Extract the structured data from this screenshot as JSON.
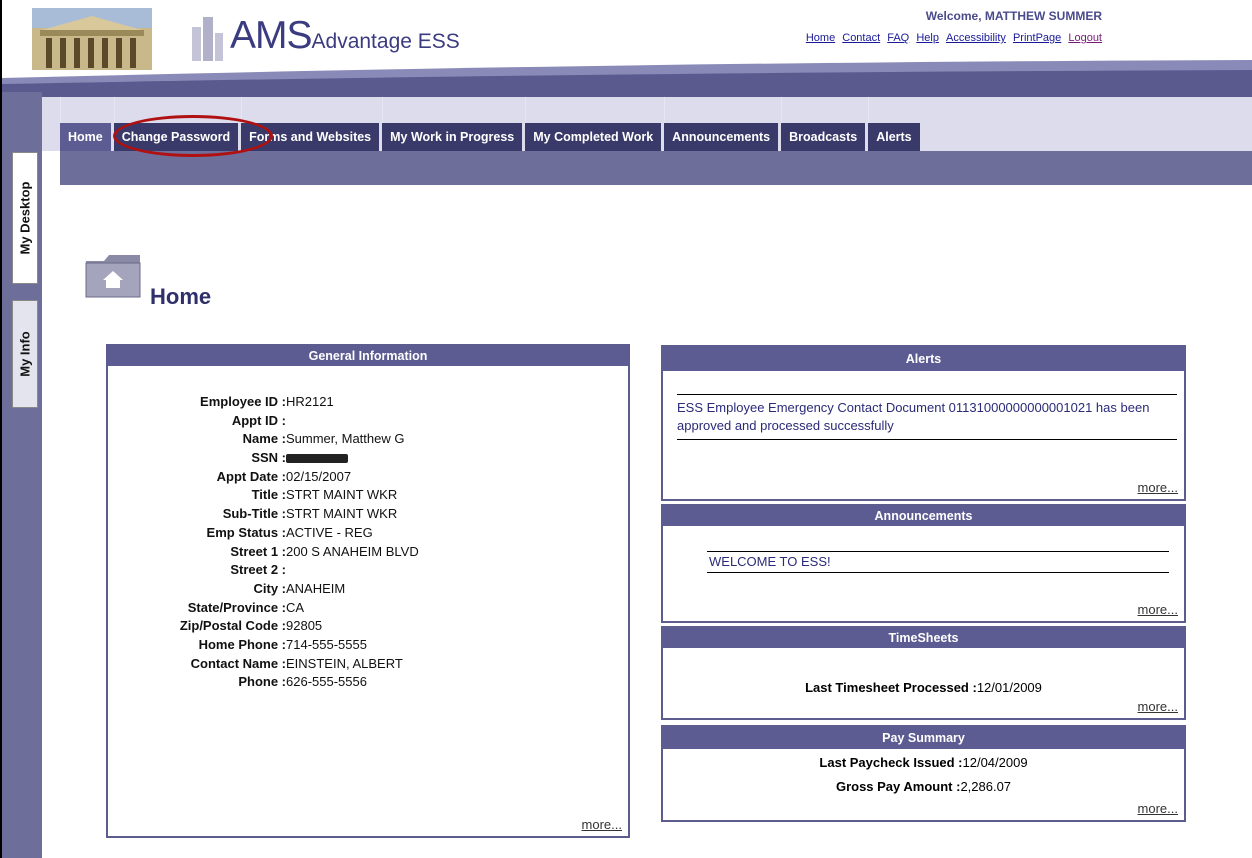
{
  "header": {
    "app_title_main": "AMS",
    "app_title_sub": "Advantage ESS",
    "welcome": "Welcome, MATTHEW SUMMER",
    "links": [
      "Home",
      "Contact",
      "FAQ",
      "Help",
      "Accessibility",
      "PrintPage",
      "Logout"
    ]
  },
  "tabs": [
    "Home",
    "Change Password",
    "Forms and Websites",
    "My Work in Progress",
    "My Completed Work",
    "Announcements",
    "Broadcasts",
    "Alerts"
  ],
  "side_tabs": [
    "My Desktop",
    "My Info"
  ],
  "page_title": "Home",
  "general": {
    "title": "General Information",
    "fields": [
      {
        "label": "Employee ID :",
        "value": "HR2121"
      },
      {
        "label": "Appt ID :",
        "value": ""
      },
      {
        "label": "Name :",
        "value": "Summer, Matthew G"
      },
      {
        "label": "SSN :",
        "value": ""
      },
      {
        "label": "Appt Date :",
        "value": "02/15/2007"
      },
      {
        "label": "Title :",
        "value": "STRT MAINT WKR"
      },
      {
        "label": "Sub-Title :",
        "value": "STRT MAINT WKR"
      },
      {
        "label": "Emp Status :",
        "value": "ACTIVE - REG"
      },
      {
        "label": "Street 1 :",
        "value": "200 S ANAHEIM BLVD"
      },
      {
        "label": "Street 2 :",
        "value": ""
      },
      {
        "label": "City :",
        "value": "ANAHEIM"
      },
      {
        "label": "State/Province :",
        "value": "CA"
      },
      {
        "label": "Zip/Postal Code :",
        "value": "92805"
      },
      {
        "label": "Home Phone :",
        "value": "714-555-5555"
      },
      {
        "label": "Contact Name :",
        "value": "EINSTEIN, ALBERT"
      },
      {
        "label": "Phone :",
        "value": "626-555-5556"
      }
    ],
    "more": "more..."
  },
  "alerts": {
    "title": "Alerts",
    "message": "ESS Employee Emergency Contact Document 01131000000000001021 has been approved and processed successfully",
    "more": "more..."
  },
  "announcements": {
    "title": "Announcements",
    "message": "WELCOME TO ESS!",
    "more": "more..."
  },
  "timesheets": {
    "title": "TimeSheets",
    "label": "Last Timesheet Processed :",
    "value": "12/01/2009",
    "more": "more..."
  },
  "pay_summary": {
    "title": "Pay Summary",
    "paycheck_label": "Last Paycheck Issued :",
    "paycheck_value": "12/04/2009",
    "gross_label": "Gross Pay Amount :",
    "gross_value": "2,286.07",
    "more": "more..."
  },
  "colors": {
    "nav_dark": "#3a3a6a",
    "frame_purple": "#6e6e9a",
    "panel_header": "#5c5c92",
    "highlight": "#b01010"
  }
}
